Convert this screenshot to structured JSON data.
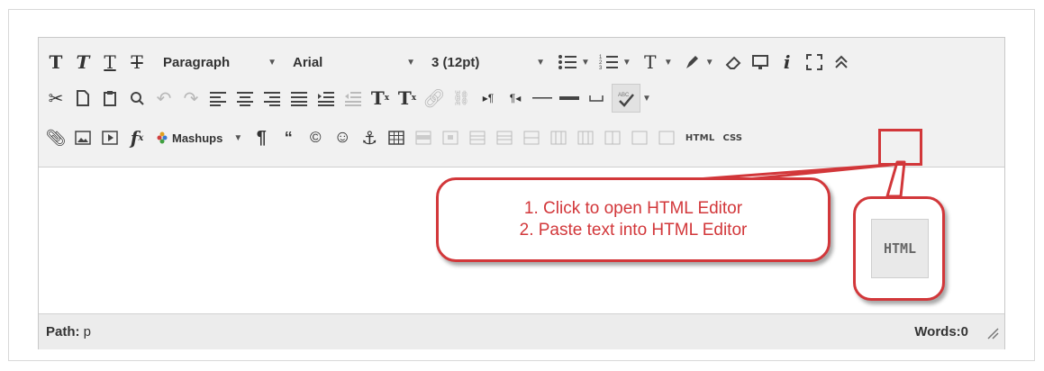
{
  "toolbar": {
    "format_dropdown": "Paragraph",
    "font_dropdown": "Arial",
    "size_dropdown": "3 (12pt)",
    "mashups_label": "Mashups",
    "html_button": "HTML",
    "css_button": "CSS",
    "row1_icons": [
      "bold-icon",
      "italic-icon",
      "underline-icon",
      "strikethrough-icon"
    ],
    "row2_icons": [
      "cut-icon",
      "copy-icon",
      "paste-icon",
      "find-icon",
      "undo-icon",
      "redo-icon",
      "align-left-icon",
      "align-center-icon",
      "align-right-icon",
      "align-justify-icon",
      "indent-icon",
      "outdent-icon",
      "superscript-icon",
      "subscript-icon",
      "link-icon",
      "unlink-icon",
      "ltr-icon",
      "rtl-icon",
      "horizontal-rule-icon",
      "thick-rule-icon",
      "nonbreaking-space-icon",
      "spellcheck-icon"
    ],
    "row3_icons": [
      "attach-icon",
      "image-icon",
      "media-icon",
      "math-icon",
      "mashups-icon",
      "paragraph-mark-icon",
      "quote-icon",
      "copyright-icon",
      "emoticon-icon",
      "anchor-icon",
      "table-icon"
    ]
  },
  "callout": {
    "line1": "1. Click to open HTML Editor",
    "line2": "2. Paste text into HTML Editor"
  },
  "zoom": {
    "label": "HTML"
  },
  "status": {
    "path_label": "Path:",
    "path_value": "p",
    "words": "Words:0"
  },
  "colors": {
    "annotation": "#d2373a",
    "toolbar_bg": "#f1f1f1"
  }
}
